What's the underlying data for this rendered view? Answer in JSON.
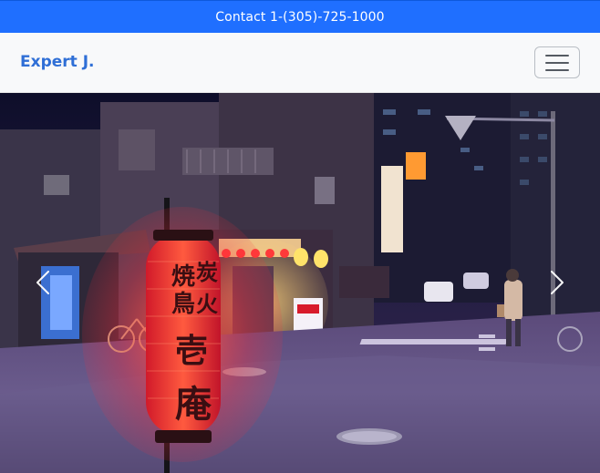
{
  "topbar": {
    "contact_text": "Contact 1-(305)-725-1000",
    "bg_color": "#1f6fff"
  },
  "navbar": {
    "brand": "Expert J.",
    "brand_color": "#2f6fd6",
    "menu_icon": "hamburger-icon"
  },
  "hero": {
    "image_description": "night street scene with red lantern",
    "prev_icon": "chevron-left-icon",
    "next_icon": "chevron-right-icon",
    "lantern_text": "焼炭 鳥火 壱庵"
  }
}
